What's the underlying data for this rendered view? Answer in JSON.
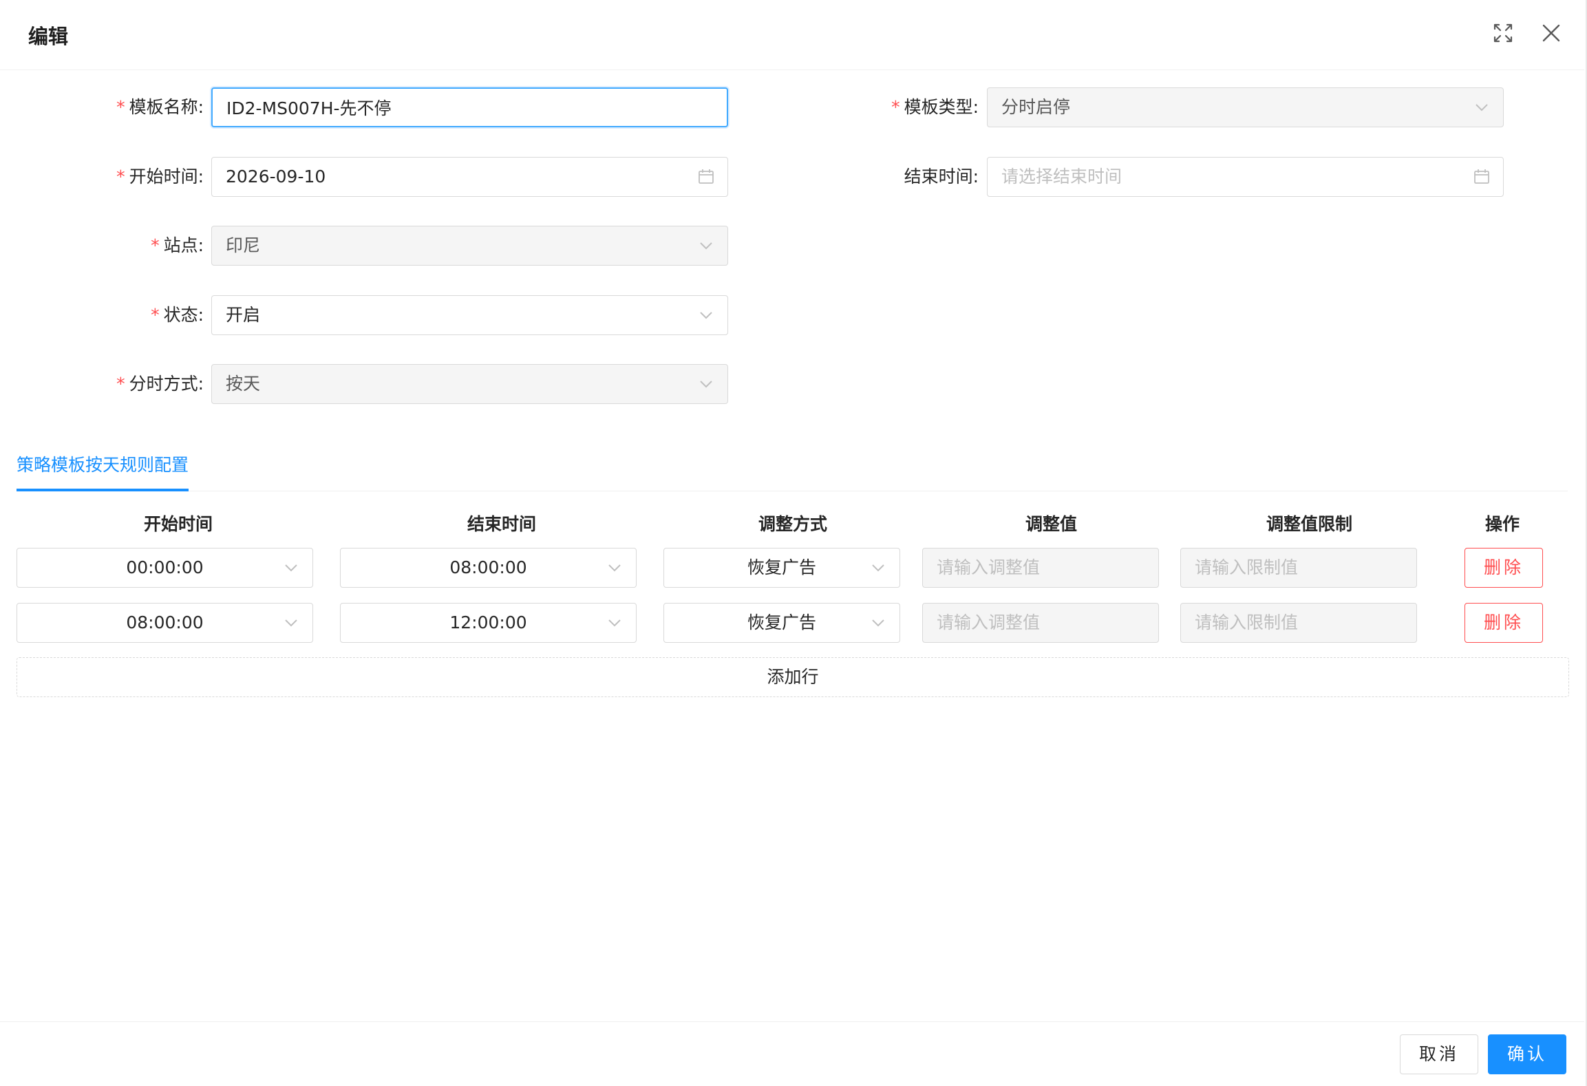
{
  "modal": {
    "title": "编辑"
  },
  "form": {
    "required_mark": "*",
    "template_name": {
      "label": "模板名称:",
      "value": "ID2-MS007H-先不停"
    },
    "template_type": {
      "label": "模板类型:",
      "value": "分时启停"
    },
    "start_time": {
      "label": "开始时间:",
      "value": "2026-09-10"
    },
    "end_time": {
      "label": "结束时间:",
      "placeholder": "请选择结束时间"
    },
    "site": {
      "label": "站点:",
      "value": "印尼"
    },
    "status": {
      "label": "状态:",
      "value": "开启"
    },
    "time_mode": {
      "label": "分时方式:",
      "value": "按天"
    }
  },
  "tabs": {
    "active": "策略模板按天规则配置"
  },
  "table": {
    "headers": [
      "开始时间",
      "结束时间",
      "调整方式",
      "调整值",
      "调整值限制",
      "操作"
    ],
    "rows": [
      {
        "start": "00:00:00",
        "end": "08:00:00",
        "method": "恢复广告",
        "value_placeholder": "请输入调整值",
        "limit_placeholder": "请输入限制值",
        "action": "删除"
      },
      {
        "start": "08:00:00",
        "end": "12:00:00",
        "method": "恢复广告",
        "value_placeholder": "请输入调整值",
        "limit_placeholder": "请输入限制值",
        "action": "删除"
      }
    ],
    "add_row_label": "添加行"
  },
  "footer": {
    "cancel_label": "取消",
    "confirm_label": "确认"
  },
  "colors": {
    "primary": "#1890ff",
    "danger": "#ff4d4f",
    "border": "#d9d9d9",
    "disabled_bg": "#f5f5f5"
  },
  "icons": {
    "expand": "fullscreen-expand-icon",
    "close": "close-icon",
    "calendar": "calendar-icon",
    "dropdown": "chevron-down-icon"
  }
}
